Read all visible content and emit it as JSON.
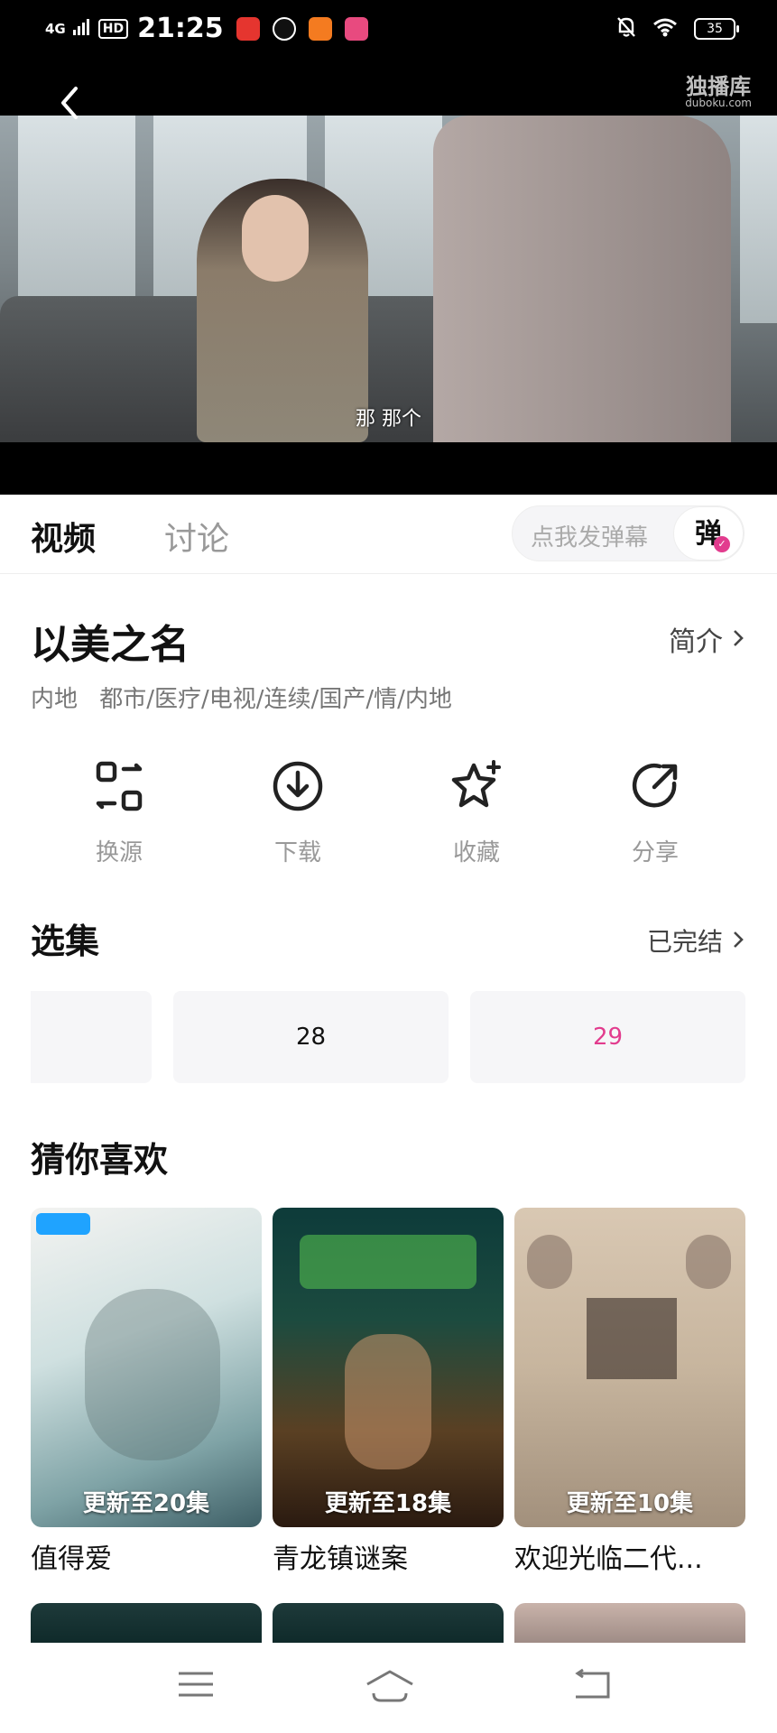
{
  "status_bar": {
    "network": "4G",
    "hd": "HD",
    "time": "21:25",
    "battery": "35"
  },
  "video": {
    "watermark": "独播库",
    "watermark_sub": "duboku.com",
    "subtitle": "那 那个"
  },
  "tabs": {
    "video": "视频",
    "discussion": "讨论"
  },
  "danmu": {
    "placeholder": "点我发弹幕",
    "button": "弹"
  },
  "show": {
    "title": "以美之名",
    "intro_label": "简介",
    "region": "内地",
    "genres": "都市/医疗/电视/连续/国产/情/内地"
  },
  "actions": [
    {
      "label": "换源",
      "icon": "switch-source-icon"
    },
    {
      "label": "下载",
      "icon": "download-icon"
    },
    {
      "label": "收藏",
      "icon": "favorite-star-icon"
    },
    {
      "label": "分享",
      "icon": "share-icon"
    }
  ],
  "episodes": {
    "title": "选集",
    "status": "已完结",
    "items": [
      {
        "label": ""
      },
      {
        "label": "28"
      },
      {
        "label": "29",
        "active": true
      }
    ],
    "active_color": "#e23c8e"
  },
  "recommend": {
    "title": "猜你喜欢",
    "items": [
      {
        "title": "值得爱",
        "badge": "更新至20集"
      },
      {
        "title": "青龙镇谜案",
        "badge": "更新至18集"
      },
      {
        "title": "欢迎光临二代...",
        "badge": "更新至10集"
      }
    ]
  },
  "nav": {
    "icons": [
      "menu-icon",
      "home-icon",
      "back-icon"
    ]
  }
}
